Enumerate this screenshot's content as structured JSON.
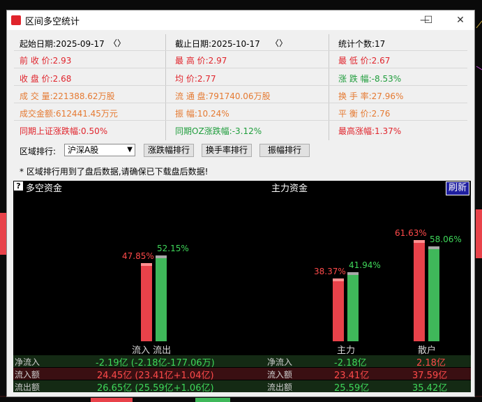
{
  "window": {
    "title": "区间多空统计",
    "minimize_glyph": "—",
    "maximize_glyph": "☐",
    "close_glyph": "✕"
  },
  "stats": {
    "start_date": "起始日期:2025-09-17",
    "end_date": "截止日期:2025-10-17",
    "count": "统计个数:17",
    "open": "前 收 价:2.93",
    "high": "最 高 价:2.97",
    "low": "最 低 价:2.67",
    "close": "收 盘 价:2.68",
    "avg": "均    价:2.77",
    "change": "涨 跌 幅:-8.53%",
    "volume": "成 交 量:221388.62万股",
    "float": "流 通 盘:791740.06万股",
    "turnover": "换 手 率:27.96%",
    "amount": "成交金额:612441.45万元",
    "amplitude": "振    幅:10.24%",
    "balance": "平 衡 价:2.76",
    "sh_change": "同期上证涨跌幅:0.50%",
    "oz_change": "同期OZ涨跌幅:-3.12%",
    "max_change": "最高涨幅:1.37%",
    "prev_arrow": "〈",
    "next_arrow": "〉"
  },
  "controls": {
    "region_label": "区域排行:",
    "region_value": "沪深A股",
    "btn_change": "涨跌幅排行",
    "btn_turnover": "换手率排行",
    "btn_amplitude": "振幅排行",
    "note": "* 区域排行用到了盘后数据,请确保已下载盘后数据!"
  },
  "panel": {
    "title_left": "多空资金",
    "title_right": "主力资金",
    "refresh": "刷新",
    "help": "?",
    "x_labels": {
      "inout": "流入 流出",
      "main": "主力",
      "retail": "散户"
    },
    "rows": [
      {
        "label": "净流入",
        "v1": "-2.19亿 (-2.18亿-177.06万)",
        "label2": "净流入",
        "v2": "-2.18亿",
        "v3": "2.18亿"
      },
      {
        "label": "流入额",
        "v1": "24.45亿 (23.41亿+1.04亿)",
        "label2": "流入额",
        "v2": "23.41亿",
        "v3": "37.59亿"
      },
      {
        "label": "流出额",
        "v1": "26.65亿 (25.59亿+1.06亿)",
        "label2": "流出额",
        "v2": "25.59亿",
        "v3": "35.42亿"
      }
    ]
  },
  "chart_data": {
    "type": "bar",
    "ylim": [
      0,
      100
    ],
    "groups": [
      {
        "category": "流入 流出",
        "in_label": "47.85%",
        "out_label": "52.15%",
        "in": 47.85,
        "out": 52.15
      },
      {
        "category": "主力",
        "in_label": "38.37%",
        "out_label": "41.94%",
        "in": 38.37,
        "out": 41.94
      },
      {
        "category": "散户",
        "in_label": "61.63%",
        "out_label": "58.06%",
        "in": 61.63,
        "out": 58.06
      }
    ],
    "colors": {
      "in": "#e8424a",
      "out": "#3fb85a"
    }
  }
}
